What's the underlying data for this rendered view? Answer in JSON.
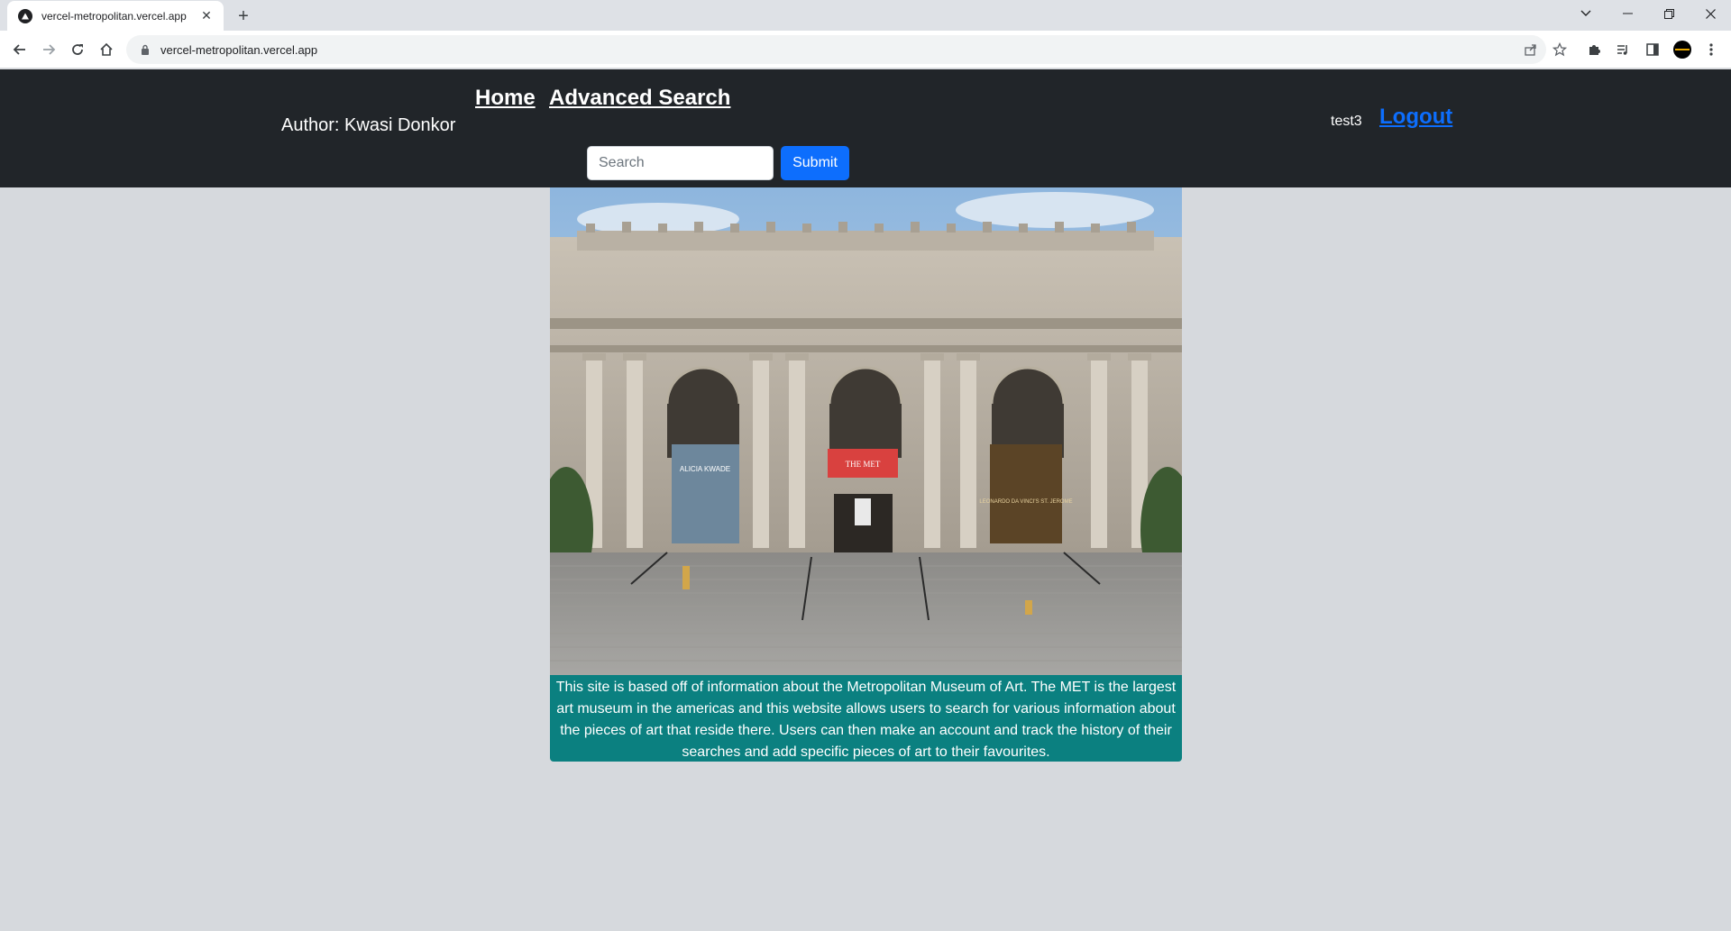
{
  "browser": {
    "tab_title": "vercel-metropolitan.vercel.app",
    "url": "vercel-metropolitan.vercel.app"
  },
  "navbar": {
    "author": "Author: Kwasi Donkor",
    "links": {
      "home": "Home",
      "advanced_search": "Advanced Search"
    },
    "search": {
      "placeholder": "Search",
      "value": "",
      "submit_label": "Submit"
    },
    "user": {
      "username": "test3",
      "logout_label": "Logout"
    },
    "colors": {
      "background": "#212529",
      "submit": "#0d6efd",
      "logout": "#0d6efd"
    }
  },
  "hero": {
    "banners": {
      "left": "ALICIA KWADE",
      "center": "THE MET",
      "right": "LEONARDO DA VINCI'S ST. JEROME"
    }
  },
  "description": {
    "text": "This site is based off of information about the Metropolitan Museum of Art. The MET is the largest art museum in the americas and this website allows users to search for various information about the pieces of art that reside there. Users can then make an account and track the history of their searches and add specific pieces of art to their favourites.",
    "background": "#0b8080"
  }
}
